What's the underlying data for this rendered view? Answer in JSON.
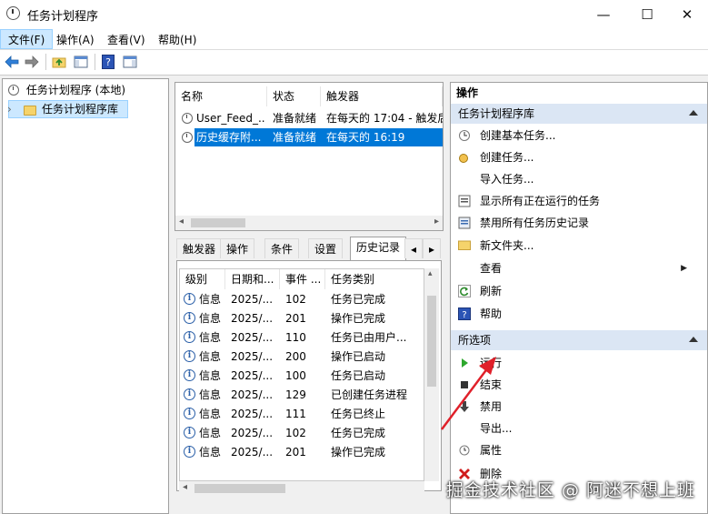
{
  "window": {
    "title": "任务计划程序",
    "minimize_glyph": "—",
    "maximize_glyph": "☐",
    "close_glyph": "✕"
  },
  "menu": [
    {
      "label": "文件(F)"
    },
    {
      "label": "操作(A)"
    },
    {
      "label": "查看(V)"
    },
    {
      "label": "帮助(H)"
    }
  ],
  "tree": {
    "root": "任务计划程序 (本地)",
    "child": "任务计划程序库",
    "expander": "›"
  },
  "tasklist": {
    "headers": [
      "名称",
      "状态",
      "触发器"
    ],
    "rows": [
      {
        "name": "User_Feed_...",
        "status": "准备就绪",
        "trigger": "在每天的 17:04 - 触发后,"
      },
      {
        "name": "历史缓存附...",
        "status": "准备就绪",
        "trigger": "在每天的 16:19"
      }
    ]
  },
  "tabs": [
    "触发器",
    "操作",
    "条件",
    "设置",
    "历史记录"
  ],
  "tab_scroll": {
    "left": "◂",
    "right": "▸"
  },
  "history": {
    "headers": [
      "级别",
      "日期和...",
      "事件 ...",
      "任务类别"
    ],
    "rows": [
      {
        "level": "信息",
        "date": "2025/...",
        "event": "102",
        "category": "任务已完成"
      },
      {
        "level": "信息",
        "date": "2025/...",
        "event": "201",
        "category": "操作已完成"
      },
      {
        "level": "信息",
        "date": "2025/...",
        "event": "110",
        "category": "任务已由用户..."
      },
      {
        "level": "信息",
        "date": "2025/...",
        "event": "200",
        "category": "操作已启动"
      },
      {
        "level": "信息",
        "date": "2025/...",
        "event": "100",
        "category": "任务已启动"
      },
      {
        "level": "信息",
        "date": "2025/...",
        "event": "129",
        "category": "已创建任务进程"
      },
      {
        "level": "信息",
        "date": "2025/...",
        "event": "111",
        "category": "任务已终止"
      },
      {
        "level": "信息",
        "date": "2025/...",
        "event": "102",
        "category": "任务已完成"
      },
      {
        "level": "信息",
        "date": "2025/...",
        "event": "201",
        "category": "操作已完成"
      }
    ]
  },
  "actions": {
    "title": "操作",
    "section1": "任务计划程序库",
    "items1": [
      "创建基本任务...",
      "创建任务...",
      "导入任务...",
      "显示所有正在运行的任务",
      "禁用所有任务历史记录",
      "新文件夹...",
      "查看",
      "刷新",
      "帮助"
    ],
    "submenu_arrow": "▶",
    "section2": "所选项",
    "items2": [
      "运行",
      "结束",
      "禁用",
      "导出...",
      "属性",
      "删除"
    ]
  },
  "watermark": "掘金技术社区 @ 阿迷不想上班",
  "colors": {
    "selection": "#0078d7",
    "section_bg": "#dbe6f4",
    "annotation_arrow": "#e0202a"
  }
}
